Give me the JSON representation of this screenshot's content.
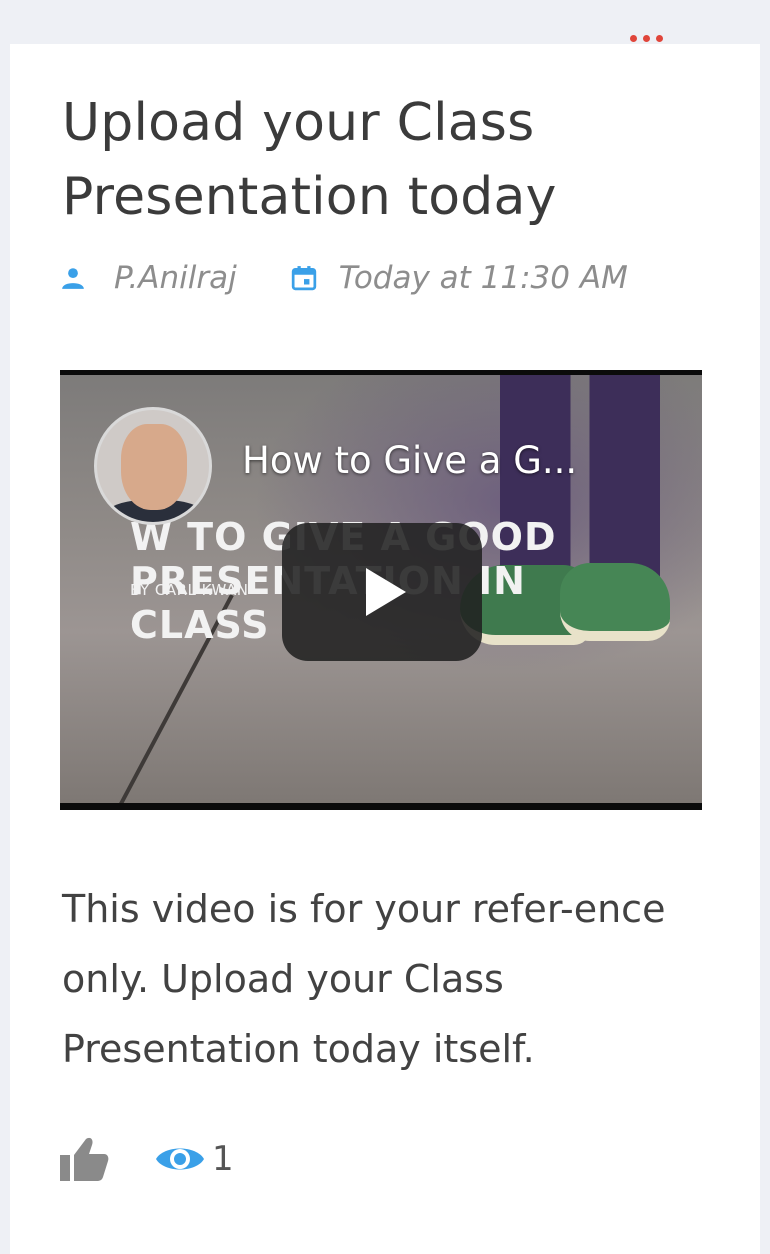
{
  "post": {
    "title": "Upload your Class Presentation today",
    "author": "P.Anilraj",
    "timestamp": "Today at 11:30 AM",
    "body": "This video is for your refer-ence only. Upload your Class Presentation today itself.",
    "views": "1"
  },
  "video": {
    "title": "How to Give a G...",
    "thumbnail_text": "W TO GIVE A GOOD PRESENTATION IN CLASS",
    "thumbnail_byline": "BY CARL KWAN"
  },
  "icons": {
    "more": "more-dots-icon",
    "author": "person-icon",
    "date": "calendar-icon",
    "like": "thumbs-up-icon",
    "views": "eye-icon",
    "play": "play-icon"
  },
  "colors": {
    "accent_blue": "#3aa0e8",
    "menu_red": "#e0453a",
    "title_text": "#3b3b3b",
    "meta_text": "#8d8d8d"
  }
}
